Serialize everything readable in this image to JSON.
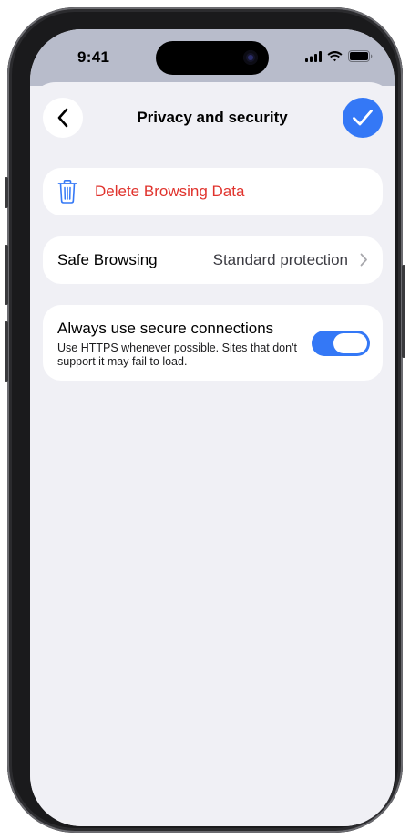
{
  "status_bar": {
    "time": "9:41",
    "icons": [
      "cellular-signal-icon",
      "wifi-icon",
      "battery-icon"
    ]
  },
  "header": {
    "title": "Privacy and security",
    "back_icon": "chevron-left-icon",
    "done_icon": "checkmark-icon"
  },
  "delete_browsing_data": {
    "label": "Delete Browsing Data",
    "icon": "trash-icon",
    "color": "#e0332d"
  },
  "safe_browsing": {
    "label": "Safe Browsing",
    "value": "Standard protection",
    "icon": "chevron-right-icon"
  },
  "https_setting": {
    "title": "Always use secure connections",
    "description": "Use HTTPS whenever possible. Sites that don't support it may fail to load.",
    "enabled": true
  },
  "colors": {
    "accent": "#3478f6",
    "background": "#f0f0f5",
    "destructive": "#e0332d"
  }
}
